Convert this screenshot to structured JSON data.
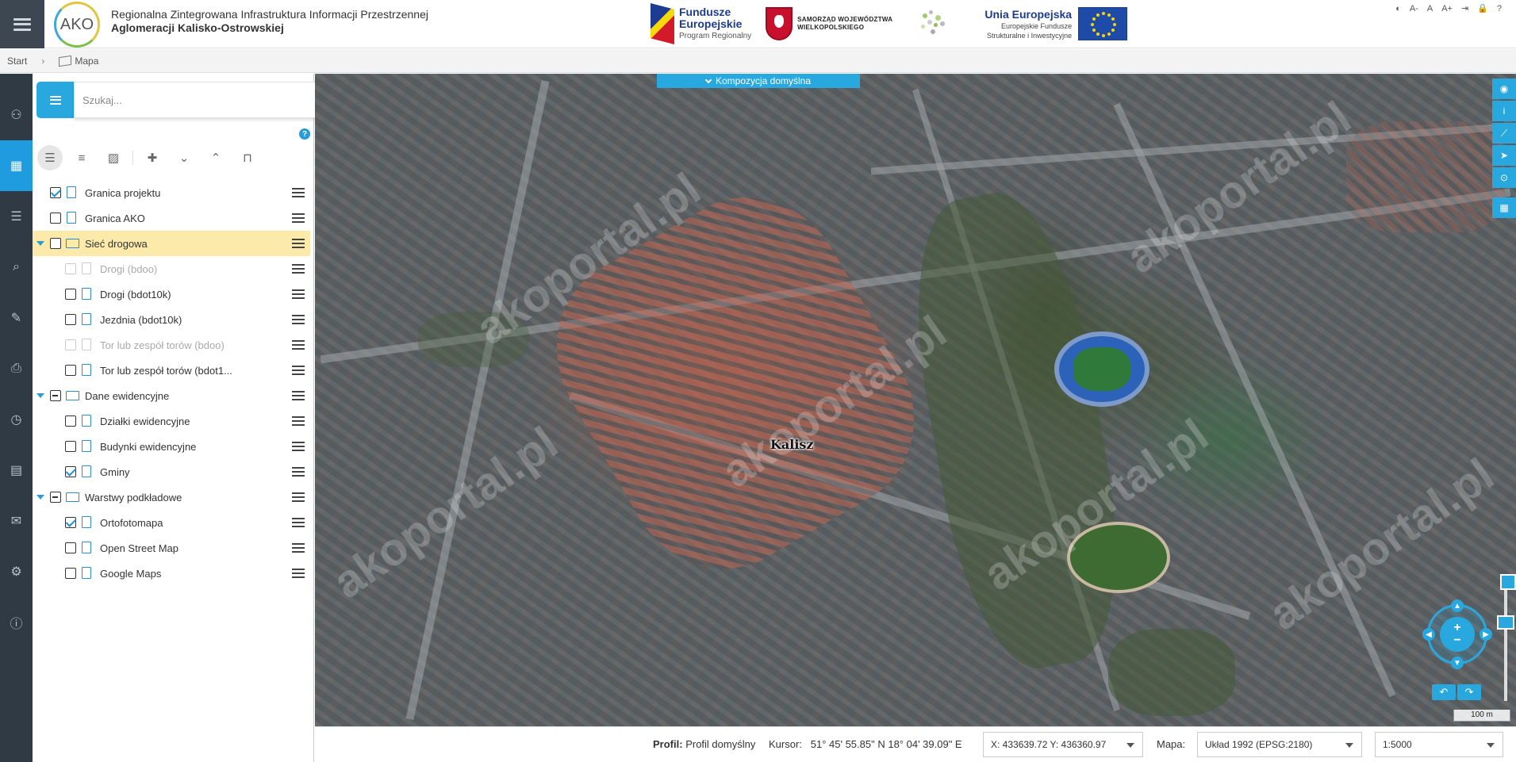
{
  "header": {
    "logo_text": "AKO",
    "title_line1": "Regionalna Zintegrowana Infrastruktura Informacji Przestrzennej",
    "title_line2": "Aglomeracji Kalisko-Ostrowskiej",
    "fe": {
      "line1": "Fundusze",
      "line2": "Europejskie",
      "line3": "Program Regionalny"
    },
    "wlkp": {
      "line1": "SAMORZĄD WOJEWÓDZTWA",
      "line2": "WIELKOPOLSKIEGO"
    },
    "ue": {
      "line1": "Unia Europejska",
      "line2": "Europejskie Fundusze",
      "line3": "Strukturalne i Inwestycyjne"
    },
    "a11y": {
      "contrast": "◐",
      "font_small": "A-",
      "font_normal": "A",
      "font_large": "A+",
      "login": "⇥",
      "lock": "🔒",
      "help": "?"
    }
  },
  "breadcrumb": {
    "start": "Start",
    "current": "Mapa"
  },
  "sidebar": {
    "search_placeholder": "Szukaj...",
    "help": "?",
    "layers": [
      {
        "label": "Granica projektu",
        "level": 1,
        "checked": "checked",
        "type": "doc"
      },
      {
        "label": "Granica AKO",
        "level": 1,
        "checked": "none",
        "type": "doc"
      },
      {
        "label": "Sieć drogowa",
        "level": 0,
        "checked": "none",
        "type": "folder",
        "highlight": true
      },
      {
        "label": "Drogi (bdoo)",
        "level": 2,
        "checked": "none",
        "type": "doc",
        "disabled": true
      },
      {
        "label": "Drogi (bdot10k)",
        "level": 2,
        "checked": "none",
        "type": "doc"
      },
      {
        "label": "Jezdnia (bdot10k)",
        "level": 2,
        "checked": "none",
        "type": "doc"
      },
      {
        "label": "Tor lub zespół torów (bdoo)",
        "level": 2,
        "checked": "none",
        "type": "doc",
        "disabled": true
      },
      {
        "label": "Tor lub zespół torów (bdot1...",
        "level": 2,
        "checked": "none",
        "type": "doc"
      },
      {
        "label": "Dane ewidencyjne",
        "level": 0,
        "checked": "partial",
        "type": "folder"
      },
      {
        "label": "Działki ewidencyjne",
        "level": 2,
        "checked": "none",
        "type": "doc"
      },
      {
        "label": "Budynki ewidencyjne",
        "level": 2,
        "checked": "none",
        "type": "doc"
      },
      {
        "label": "Gminy",
        "level": 2,
        "checked": "checked",
        "type": "doc"
      },
      {
        "label": "Warstwy podkładowe",
        "level": 0,
        "checked": "partial",
        "type": "folder"
      },
      {
        "label": "Ortofotomapa",
        "level": 2,
        "checked": "checked",
        "type": "doc"
      },
      {
        "label": "Open Street Map",
        "level": 2,
        "checked": "none",
        "type": "doc"
      },
      {
        "label": "Google Maps",
        "level": 2,
        "checked": "none",
        "type": "doc"
      }
    ]
  },
  "map": {
    "composition": "Kompozycja domyślna",
    "city_label": "Kalisz",
    "watermark": "akoportal.pl",
    "scale": "100 m"
  },
  "status": {
    "profile_label": "Profil:",
    "profile_value": "Profil domyślny",
    "cursor_label": "Kursor:",
    "cursor_value": "51° 45' 55.85\" N 18° 04' 39.09\" E",
    "xy_value": "X: 433639.72 Y: 436360.97",
    "mapa_label": "Mapa:",
    "crs_value": "Układ 1992 (EPSG:2180)",
    "scale_value": "1:5000"
  },
  "colors": {
    "accent": "#29a8e0",
    "rail": "#2f3a45",
    "highlight": "#fbeaaa"
  }
}
